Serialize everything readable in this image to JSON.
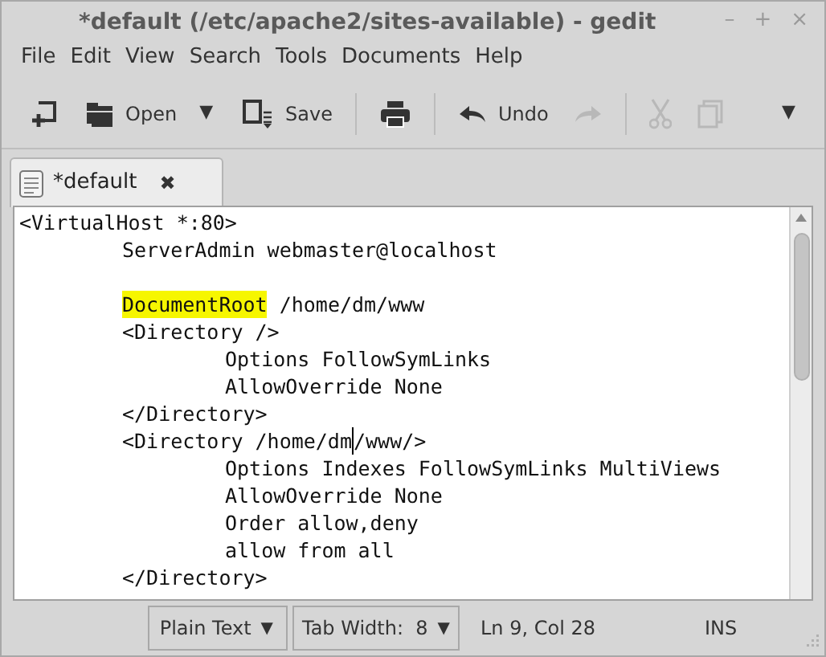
{
  "window": {
    "title": "*default (/etc/apache2/sites-available) - gedit",
    "controls": [
      "–",
      "+",
      "×"
    ]
  },
  "menu": [
    "File",
    "Edit",
    "View",
    "Search",
    "Tools",
    "Documents",
    "Help"
  ],
  "toolbar": [
    {
      "kind": "new",
      "disabled": false
    },
    {
      "kind": "open",
      "label": "Open",
      "disabled": false
    },
    {
      "kind": "dropdown",
      "label": "▼",
      "disabled": false
    },
    {
      "kind": "save",
      "label": "Save",
      "disabled": false
    },
    {
      "kind": "separator"
    },
    {
      "kind": "print",
      "disabled": false
    },
    {
      "kind": "separator"
    },
    {
      "kind": "undo",
      "label": "Undo",
      "disabled": false
    },
    {
      "kind": "redo",
      "disabled": true
    },
    {
      "kind": "separator"
    },
    {
      "kind": "cut",
      "disabled": true
    },
    {
      "kind": "copy",
      "disabled": true
    },
    {
      "kind": "overflow",
      "label": "▼",
      "disabled": false
    }
  ],
  "tabs": [
    {
      "label": "*default",
      "close": "✖",
      "selected": true
    }
  ],
  "editor": {
    "lines": [
      {
        "text": "<VirtualHost *:80>",
        "blank_line_after": false,
        "children": [
          {
            "text": "ServerAdmin webmaster@localhost",
            "blank_line_after": true
          },
          {
            "segments": [
              {
                "text": "DocumentRoot",
                "highlighted": true
              },
              {
                "text": " /home/dm/www",
                "highlighted": false
              }
            ],
            "blank_line_after": false
          },
          {
            "text": "<Directory />",
            "blank_line_after": false,
            "children": [
              {
                "text": "Options FollowSymLinks",
                "blank_line_after": false
              },
              {
                "text": "AllowOverride None",
                "blank_line_after": false
              }
            ]
          },
          {
            "text": "</Directory>",
            "blank_line_after": false
          },
          {
            "segments": [
              {
                "text": "<Directory /home/dm",
                "caret_after": true
              },
              {
                "text": "/www/>",
                "caret_after": false
              }
            ],
            "blank_line_after": false,
            "children": [
              {
                "text": "Options Indexes FollowSymLinks MultiViews",
                "blank_line_after": false
              },
              {
                "text": "AllowOverride None",
                "blank_line_after": false
              },
              {
                "text": "Order allow,deny",
                "blank_line_after": false
              },
              {
                "text": "allow from all",
                "blank_line_after": false
              }
            ]
          },
          {
            "text": "</Directory>",
            "blank_line_after": false
          }
        ]
      }
    ]
  },
  "status_bar": {
    "language": "Plain Text",
    "tab_width": "Tab Width:  8",
    "arrow": "▼",
    "position": "Ln 9, Col 28",
    "mode": "INS"
  }
}
